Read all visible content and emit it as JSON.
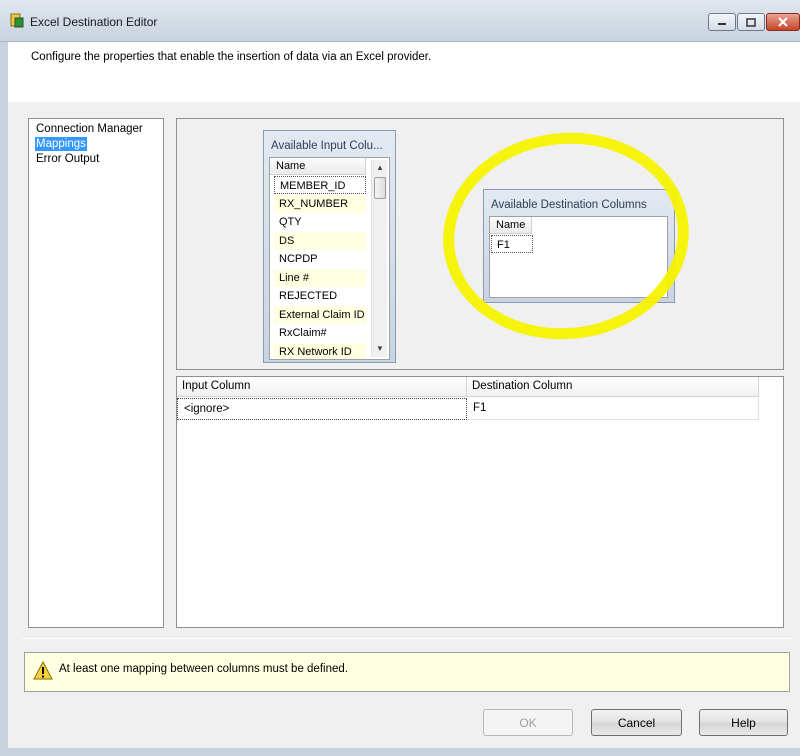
{
  "window": {
    "title": "Excel Destination Editor",
    "description": "Configure the properties that enable the insertion of data via an Excel provider."
  },
  "nav": {
    "items": [
      {
        "label": "Connection Manager",
        "selected": false
      },
      {
        "label": "Mappings",
        "selected": true
      },
      {
        "label": "Error Output",
        "selected": false
      }
    ]
  },
  "input_table": {
    "title": "Available Input Colu...",
    "header": "Name",
    "rows": [
      "MEMBER_ID",
      "RX_NUMBER",
      "QTY",
      "DS",
      "NCPDP",
      "Line #",
      "REJECTED",
      "External Claim ID",
      "RxClaim#",
      "RX Network ID"
    ]
  },
  "dest_table": {
    "title": "Available Destination Columns",
    "header": "Name",
    "rows": [
      "F1"
    ]
  },
  "grid": {
    "headers": [
      "Input Column",
      "Destination Column"
    ],
    "rows": [
      [
        "<ignore>",
        "F1"
      ]
    ]
  },
  "warning": {
    "text": "At least one mapping between columns must be defined."
  },
  "buttons": {
    "ok": "OK",
    "cancel": "Cancel",
    "help": "Help"
  },
  "colors": {
    "highlight_circle": "#f5f200",
    "selection": "#3399ff",
    "row_alt": "#ffffe1"
  }
}
